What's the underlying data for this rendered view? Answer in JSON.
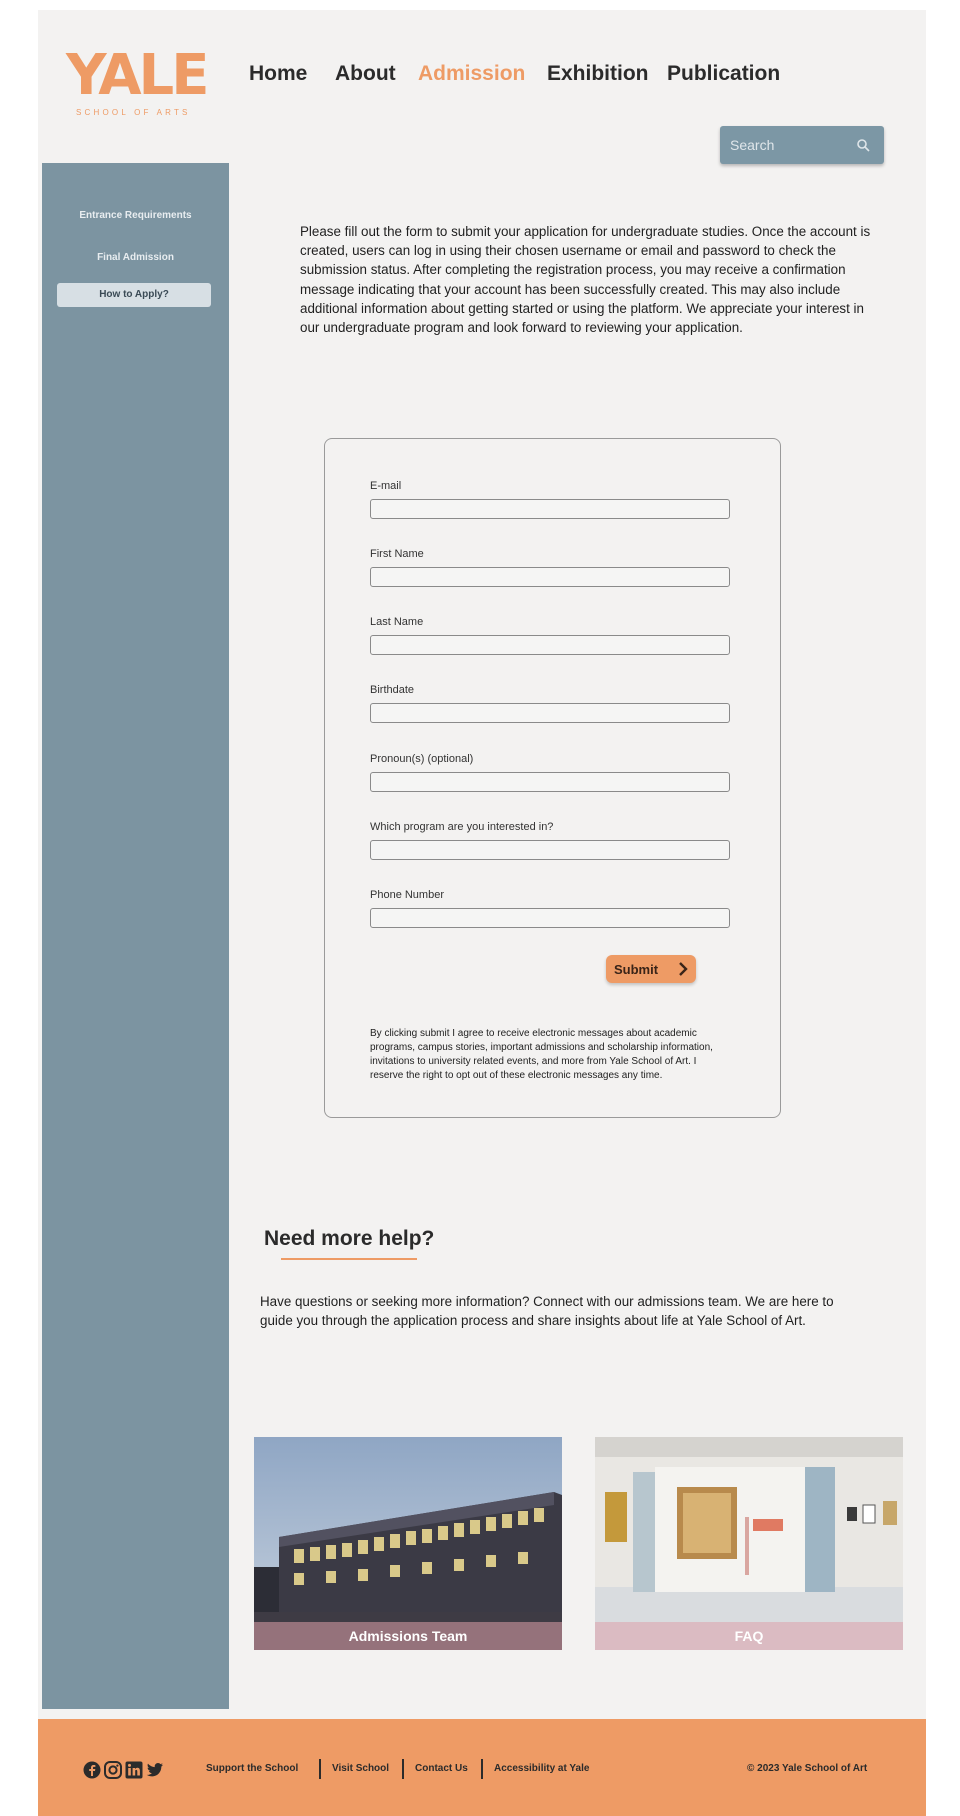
{
  "logo": {
    "main": "YALE",
    "sub": "SCHOOL OF ARTS"
  },
  "nav": {
    "items": [
      {
        "label": "Home"
      },
      {
        "label": "About"
      },
      {
        "label": "Admission"
      },
      {
        "label": "Exhibition"
      },
      {
        "label": "Publication"
      }
    ],
    "active": "Admission"
  },
  "search": {
    "placeholder": "Search"
  },
  "sidebar": {
    "items": [
      {
        "label": "Entrance Requirements"
      },
      {
        "label": "Final Admission"
      },
      {
        "label": "How to Apply?"
      }
    ],
    "active": "How to Apply?"
  },
  "intro": {
    "text": "Please fill out the form to submit your application for undergraduate studies. Once the account is created, users can log in using their chosen username or email and password to check the submission status. After completing the registration process, you may receive a confirmation message indicating that your account has been successfully created. This may also include additional information about getting started or using the platform. We appreciate your interest in our undergraduate program and look forward to reviewing your application."
  },
  "form": {
    "fields": [
      {
        "label": "E-mail",
        "value": ""
      },
      {
        "label": "First Name",
        "value": ""
      },
      {
        "label": "Last Name",
        "value": ""
      },
      {
        "label": "Birthdate",
        "value": ""
      },
      {
        "label": "Pronoun(s) (optional)",
        "value": ""
      },
      {
        "label": "Which program are you interested in?",
        "value": ""
      },
      {
        "label": "Phone Number",
        "value": ""
      }
    ],
    "submit_label": "Submit",
    "disclaimer": "By clicking submit I agree to receive electronic messages about academic programs, campus stories, important admissions and scholarship information, invitations to university related events, and more from Yale School of Art. I reserve the right to opt out of these electronic messages any time."
  },
  "help": {
    "title": "Need more help?",
    "text": "Have questions or seeking more information? Connect with our admissions team. We are here to guide you through the application process and share insights about life at Yale School of Art."
  },
  "cards": [
    {
      "caption": "Admissions Team"
    },
    {
      "caption": "FAQ"
    }
  ],
  "footer": {
    "social_icons": [
      "facebook-icon",
      "instagram-icon",
      "linkedin-icon",
      "twitter-icon"
    ],
    "links": [
      {
        "label": "Support the School"
      },
      {
        "label": "Visit School"
      },
      {
        "label": "Contact Us"
      },
      {
        "label": "Accessibility at Yale"
      }
    ],
    "copyright": "© 2023 Yale School of Art"
  },
  "colors": {
    "accent": "#ee9b65",
    "sidebar": "#7c94a1",
    "background": "#f3f2f1"
  }
}
